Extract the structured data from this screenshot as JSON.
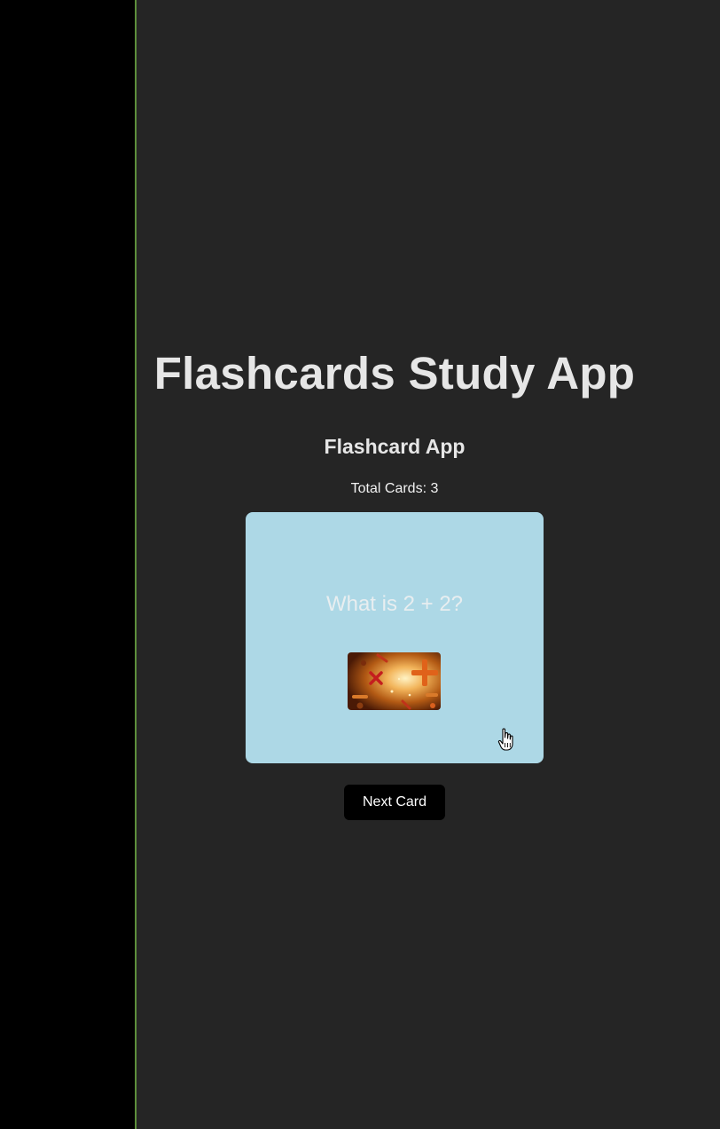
{
  "header": {
    "title": "Flashcards Study App"
  },
  "app": {
    "subtitle": "Flashcard App",
    "total_cards_label": "Total Cards: 3"
  },
  "card": {
    "question": "What is 2 + 2?",
    "image_icon": "math-symbols-image",
    "background_color": "#add8e6"
  },
  "controls": {
    "next_label": "Next Card"
  },
  "colors": {
    "page_background": "#252525",
    "left_panel": "#000000",
    "left_border": "#5d8f3b",
    "button_background": "#000000"
  }
}
